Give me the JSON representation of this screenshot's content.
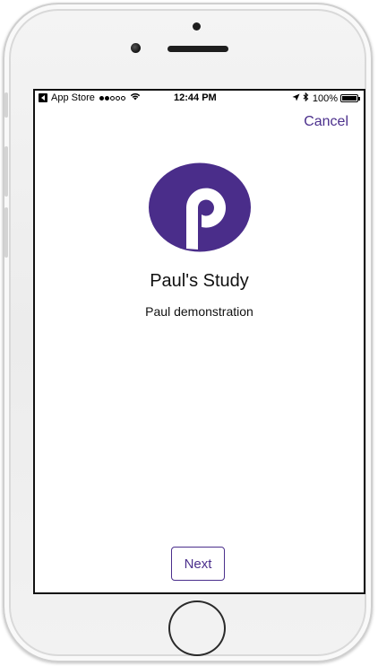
{
  "status_bar": {
    "back_label": "App Store",
    "time": "12:44 PM",
    "battery": "100%",
    "signal_bars_filled": 2,
    "signal_bars_total": 5
  },
  "header": {
    "cancel_label": "Cancel"
  },
  "study": {
    "logo_letter": "p",
    "title": "Paul's Study",
    "subtitle": "Paul demonstration"
  },
  "footer": {
    "next_label": "Next"
  },
  "colors": {
    "accent": "#4b2f8c",
    "logo_bg": "#4a2d8a"
  },
  "icons": [
    "back-app-icon",
    "wifi-icon",
    "location-arrow-icon",
    "bluetooth-icon",
    "battery-icon",
    "study-logo-icon",
    "home-button"
  ]
}
